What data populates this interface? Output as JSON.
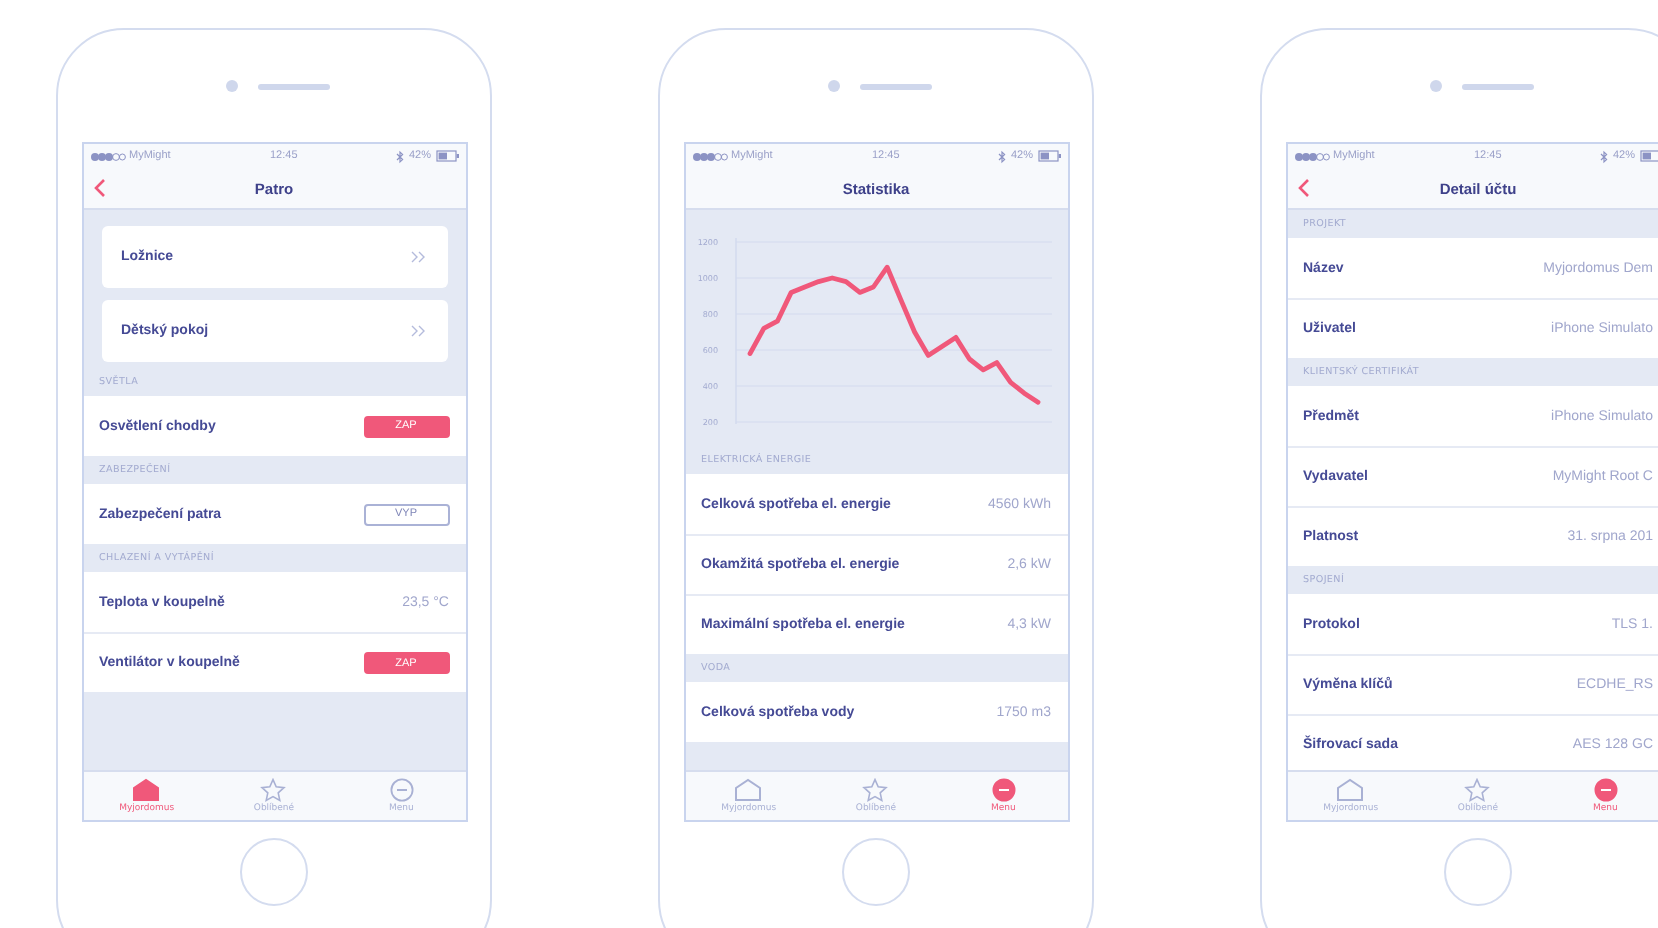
{
  "phones": [
    {
      "status": {
        "carrier": "MyMight",
        "time": "12:45",
        "battery": "42%"
      },
      "nav": {
        "title": "Patro",
        "back": true
      },
      "sections": [
        {
          "kind": "cards",
          "rows": [
            {
              "kind": "link",
              "label": "Ložnice"
            },
            {
              "kind": "link",
              "label": "Dětský pokoj"
            }
          ]
        },
        {
          "kind": "list",
          "header": "SVĚTLA",
          "rows": [
            {
              "kind": "toggle",
              "label": "Osvětlení chodby",
              "text": "ZAP",
              "on": true
            }
          ]
        },
        {
          "kind": "list",
          "header": "ZABEZPEČENÍ",
          "rows": [
            {
              "kind": "toggle",
              "label": "Zabezpečení patra",
              "text": "VYP",
              "on": false
            }
          ]
        },
        {
          "kind": "list",
          "header": "CHLAZENÍ A VYTÁPĚNÍ",
          "rows": [
            {
              "kind": "value",
              "label": "Teplota v koupelně",
              "value": "23,5 °C"
            },
            {
              "kind": "toggle",
              "label": "Ventilátor v koupelně",
              "text": "ZAP",
              "on": true
            }
          ]
        }
      ],
      "tabs": [
        {
          "kind": "home",
          "label": "Myjordomus",
          "selected": true
        },
        {
          "kind": "star",
          "label": "Oblíbené",
          "selected": false
        },
        {
          "kind": "menu",
          "label": "Menu",
          "selected": false
        }
      ]
    },
    {
      "status": {
        "carrier": "MyMight",
        "time": "12:45",
        "battery": "42%"
      },
      "nav": {
        "title": "Statistika",
        "back": false
      },
      "sections": [
        {
          "kind": "chart",
          "chart_data": {
            "type": "line",
            "yticks": [
              200,
              400,
              600,
              800,
              1000,
              1200
            ],
            "ylim": [
              200,
              1200
            ],
            "grid": true,
            "series": [
              {
                "color": "#f0587a",
                "values": [
                  580,
                  720,
                  760,
                  920,
                  950,
                  980,
                  1000,
                  980,
                  920,
                  950,
                  1060,
                  880,
                  700,
                  570,
                  620,
                  670,
                  550,
                  490,
                  530,
                  420,
                  360,
                  310
                ]
              }
            ]
          }
        },
        {
          "kind": "list",
          "header": "ELEKTRICKÁ ENERGIE",
          "rows": [
            {
              "kind": "value",
              "label": "Celková spotřeba el. energie",
              "value": "4560 kWh"
            },
            {
              "kind": "value",
              "label": "Okamžitá spotřeba el. energie",
              "value": "2,6 kW"
            },
            {
              "kind": "value",
              "label": "Maximální spotřeba el. energie",
              "value": "4,3 kW"
            }
          ]
        },
        {
          "kind": "list",
          "header": "VODA",
          "rows": [
            {
              "kind": "value",
              "label": "Celková spotřeba vody",
              "value": "1750 m3"
            }
          ]
        }
      ],
      "tabs": [
        {
          "kind": "home",
          "label": "Myjordomus",
          "selected": false
        },
        {
          "kind": "star",
          "label": "Oblíbené",
          "selected": false
        },
        {
          "kind": "menu",
          "label": "Menu",
          "selected": true
        }
      ]
    },
    {
      "status": {
        "carrier": "MyMight",
        "time": "12:45",
        "battery": "42%"
      },
      "nav": {
        "title": "Detail účtu",
        "back": true
      },
      "sections": [
        {
          "kind": "list",
          "header": "PROJEKT",
          "rows": [
            {
              "kind": "value",
              "label": "Název",
              "value": "Myjordomus Dem"
            },
            {
              "kind": "value",
              "label": "Uživatel",
              "value": "iPhone Simulato"
            }
          ]
        },
        {
          "kind": "list",
          "header": "KLIENTSKÝ CERTIFIKÁT",
          "rows": [
            {
              "kind": "value",
              "label": "Předmět",
              "value": "iPhone Simulato"
            },
            {
              "kind": "value",
              "label": "Vydavatel",
              "value": "MyMight Root C"
            },
            {
              "kind": "value",
              "label": "Platnost",
              "value": "31. srpna 201"
            }
          ]
        },
        {
          "kind": "list",
          "header": "SPOJENÍ",
          "rows": [
            {
              "kind": "value",
              "label": "Protokol",
              "value": "TLS 1."
            },
            {
              "kind": "value",
              "label": "Výměna klíčů",
              "value": "ECDHE_RS"
            },
            {
              "kind": "value",
              "label": "Šifrovací sada",
              "value": "AES 128 GC"
            }
          ]
        }
      ],
      "tabs": [
        {
          "kind": "home",
          "label": "Myjordomus",
          "selected": false
        },
        {
          "kind": "star",
          "label": "Oblíbené",
          "selected": false
        },
        {
          "kind": "menu",
          "label": "Menu",
          "selected": true
        }
      ]
    }
  ]
}
